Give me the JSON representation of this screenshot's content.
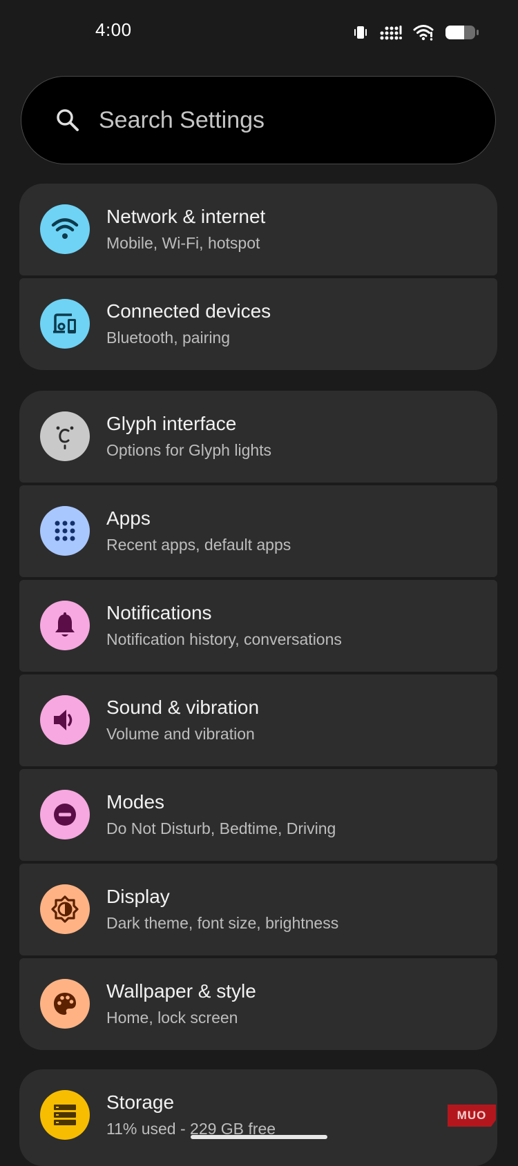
{
  "status_bar": {
    "time": "4:00",
    "icons": [
      "vibrate-icon",
      "cellular-signal-icon",
      "wifi-icon",
      "battery-icon"
    ]
  },
  "search": {
    "placeholder": "Search Settings",
    "icon": "search-icon"
  },
  "groups": [
    {
      "items": [
        {
          "id": "network",
          "title": "Network & internet",
          "subtitle": "Mobile, Wi-Fi, hotspot",
          "icon": "wifi-icon",
          "icon_bg": "#6fd3f5"
        },
        {
          "id": "connected-devices",
          "title": "Connected devices",
          "subtitle": "Bluetooth, pairing",
          "icon": "connected-devices-icon",
          "icon_bg": "#6fd3f5"
        }
      ]
    },
    {
      "items": [
        {
          "id": "glyph",
          "title": "Glyph interface",
          "subtitle": "Options for Glyph lights",
          "icon": "glyph-icon",
          "icon_bg": "#c9c9c9"
        },
        {
          "id": "apps",
          "title": "Apps",
          "subtitle": "Recent apps, default apps",
          "icon": "apps-grid-icon",
          "icon_bg": "#a9c7ff"
        },
        {
          "id": "notifications",
          "title": "Notifications",
          "subtitle": "Notification history, conversations",
          "icon": "bell-icon",
          "icon_bg": "#f7a8e0"
        },
        {
          "id": "sound",
          "title": "Sound & vibration",
          "subtitle": "Volume and vibration",
          "icon": "speaker-icon",
          "icon_bg": "#f7a8e0"
        },
        {
          "id": "modes",
          "title": "Modes",
          "subtitle": "Do Not Disturb, Bedtime, Driving",
          "icon": "do-not-disturb-icon",
          "icon_bg": "#f7a8e0"
        },
        {
          "id": "display",
          "title": "Display",
          "subtitle": "Dark theme, font size, brightness",
          "icon": "brightness-icon",
          "icon_bg": "#ffb385"
        },
        {
          "id": "wallpaper",
          "title": "Wallpaper & style",
          "subtitle": "Home, lock screen",
          "icon": "palette-icon",
          "icon_bg": "#ffb385"
        }
      ]
    },
    {
      "items": [
        {
          "id": "storage",
          "title": "Storage",
          "subtitle": "11% used - 229 GB free",
          "icon": "storage-icon",
          "icon_bg": "#f7bd00"
        }
      ]
    }
  ],
  "watermark": {
    "text": "MUO"
  }
}
